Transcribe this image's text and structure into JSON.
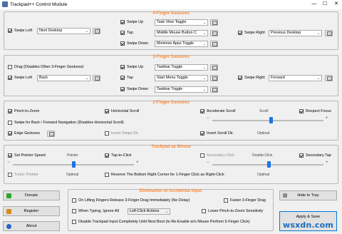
{
  "window": {
    "title": "Trackpad++ Control Module",
    "min": "—",
    "max": "☐",
    "close": "✕"
  },
  "colors": {
    "section_title": "#ff8a33",
    "accent": "#1e73e8",
    "donate": "#2aa82a",
    "register": "#d98a1c",
    "about": "#2a63c8"
  },
  "four_finger": {
    "title": "4-Finger Gestures",
    "swipe_left": {
      "label": "Swipe Left",
      "value": "Next Desktop",
      "checked": true
    },
    "swipe_up": {
      "label": "Swipe Up",
      "value": "Task View Toggle",
      "checked": true
    },
    "tap": {
      "label": "Tap",
      "value": "Middle Mouse Button C",
      "checked": true
    },
    "swipe_down": {
      "label": "Swipe Down",
      "value": "Minimize Apps Toggle",
      "checked": true
    },
    "swipe_right": {
      "label": "Swipe Right",
      "value": "Previous Desktop",
      "checked": true
    }
  },
  "three_finger": {
    "title": "3-Finger Gestures",
    "drag": {
      "label": "Drag (Disables Other 3-Finger Gestures)",
      "checked": false
    },
    "swipe_left": {
      "label": "Swipe Left",
      "value": "Back",
      "checked": true
    },
    "swipe_up": {
      "label": "Swipe Up",
      "value": "Taskbar Toggle",
      "checked": true
    },
    "tap": {
      "label": "Tap",
      "value": "Start Menu Toggle",
      "checked": true
    },
    "swipe_down": {
      "label": "Swipe Down",
      "value": "Taskbar Toggle",
      "checked": true
    },
    "swipe_right": {
      "label": "Swipe Right",
      "value": "Forward",
      "checked": true
    }
  },
  "two_finger": {
    "title": "2-Finger Gestures",
    "pinch": {
      "label": "Pinch-to-Zoom",
      "checked": true
    },
    "hscroll": {
      "label": "Horizontal Scroll",
      "checked": true
    },
    "accel": {
      "label": "Accelerate Scroll",
      "checked": true
    },
    "respect_focus": {
      "label": "Respect Focus",
      "checked": true
    },
    "swipe_back": {
      "label": "Swipe for Back / Forward Navigation (Disables Horizontal Scroll)",
      "checked": false
    },
    "edge": {
      "label": "Edge Gestures",
      "checked": true
    },
    "invert_swipe": {
      "label": "Invert Swipe Dir.",
      "checked": false
    },
    "invert_scroll": {
      "label": "Invert Scroll Dir.",
      "checked": true
    },
    "scroll_label": "Scroll",
    "scroll_optimal": "Optimal",
    "scroll_value": 0.53,
    "minus": "−",
    "plus": "+"
  },
  "mouse": {
    "title": "Trackpad as Mouse",
    "pointer_speed": {
      "label": "Set Pointer Speed",
      "checked": true
    },
    "tap_to_click": {
      "label": "Tap-to-Click",
      "checked": true
    },
    "secondary_click": {
      "label": "Secondary Click",
      "checked": false
    },
    "secondary_tap": {
      "label": "Secondary Tap",
      "checked": true
    },
    "turbo": {
      "label": "Turbo: Pointer",
      "checked": false
    },
    "reserve": {
      "label": "Reserve The Bottom Right Corner for 1-Finger Click as Right-Click",
      "checked": false
    },
    "pointer_label": "Pointer",
    "pointer_optimal": "Optimal",
    "pointer_value": 0.5,
    "dblclick_label": "Double-Click",
    "dblclick_optimal": "Optimal",
    "dblclick_value": 0.51,
    "minus": "−",
    "plus": "+"
  },
  "accidental": {
    "title": "Elimination of Accidental Input",
    "lifting": {
      "label": "On Lifting Fingers Release 3-Finger Drag Immediately (No Delay)",
      "checked": false
    },
    "faster_drag": {
      "label": "Faster 3-Finger Drag",
      "checked": false
    },
    "typing": {
      "label": "When Typing, Ignore All",
      "checked": false
    },
    "typing_value": "Left-Click Actions",
    "lower_pinch": {
      "label": "Lower Pinch-to-Zoom Sensitivity",
      "checked": false
    },
    "disable": {
      "label": "Disable Trackpad Input Completely Until Next Boot (to Re-Enable w/o Mouse Perform 5-Finger Click)",
      "checked": false
    }
  },
  "buttons": {
    "donate": "Donate",
    "register": "Register",
    "about": "About",
    "hide": "Hide to Tray",
    "apply": "Apply & Save"
  },
  "watermark": "wsxdn.com"
}
